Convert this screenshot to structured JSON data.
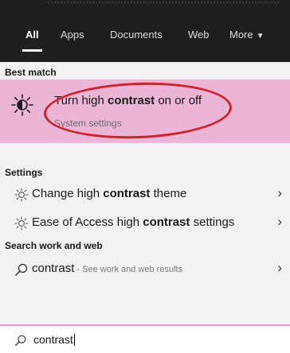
{
  "tabs": [
    {
      "label": "All",
      "active": true
    },
    {
      "label": "Apps",
      "active": false
    },
    {
      "label": "Documents",
      "active": false
    },
    {
      "label": "Web",
      "active": false
    },
    {
      "label": "More",
      "active": false
    }
  ],
  "sections": {
    "best_match": "Best match",
    "settings": "Settings",
    "search_web": "Search work and web"
  },
  "best_match": {
    "title_pre": "Turn high ",
    "title_kw": "contrast",
    "title_post": " on or off",
    "subtitle": "System settings",
    "icon": "sun-icon"
  },
  "settings_items": [
    {
      "pre": "Change high ",
      "kw": "contrast",
      "post": " theme",
      "icon": "gear-sun-icon"
    },
    {
      "pre": "Ease of Access high ",
      "kw": "contrast",
      "post": " settings",
      "icon": "gear-sun-icon"
    }
  ],
  "web_item": {
    "kw": "contrast",
    "sep": " - ",
    "hint": "See work and web results",
    "icon": "search-icon"
  },
  "search": {
    "value": "contrast",
    "icon": "search-icon"
  },
  "colors": {
    "selection": "#ebb6d6",
    "accent_ring": "#d41f2a",
    "topbar": "#1f1f1f"
  }
}
